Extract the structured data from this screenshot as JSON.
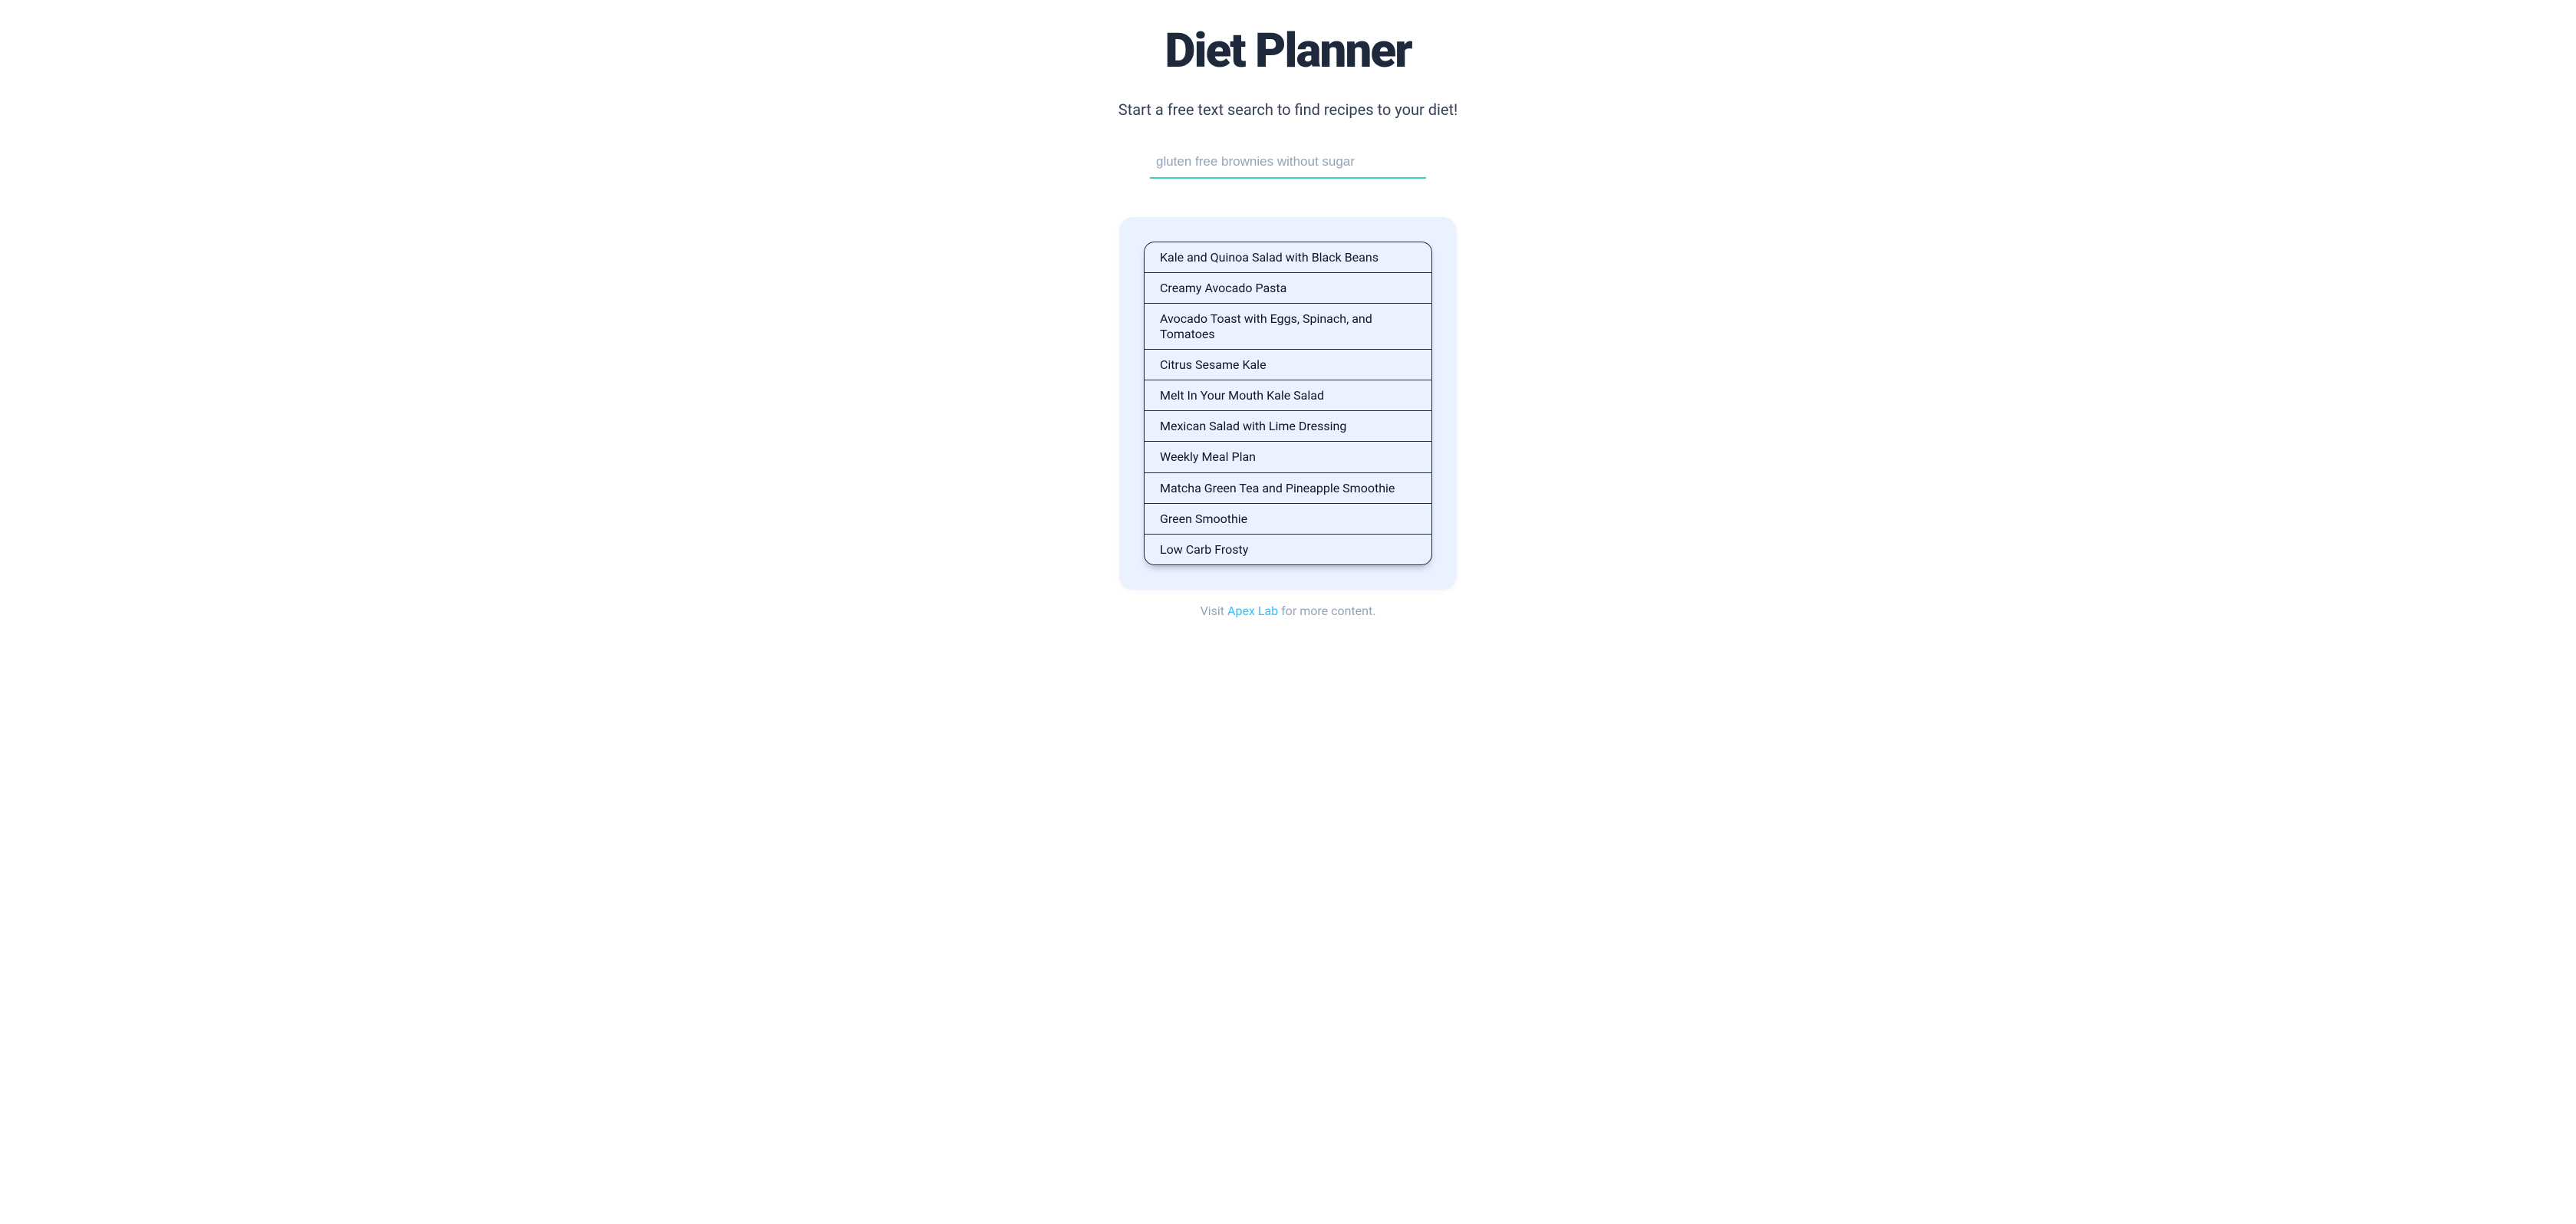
{
  "header": {
    "title": "Diet Planner",
    "subtitle": "Start a free text search to find recipes to your diet!"
  },
  "search": {
    "value": "",
    "placeholder": "gluten free brownies without sugar"
  },
  "results": [
    {
      "label": "Kale and Quinoa Salad with Black Beans"
    },
    {
      "label": "Creamy Avocado Pasta"
    },
    {
      "label": "Avocado Toast with Eggs, Spinach, and Tomatoes"
    },
    {
      "label": "Citrus Sesame Kale"
    },
    {
      "label": "Melt In Your Mouth Kale Salad"
    },
    {
      "label": "Mexican Salad with Lime Dressing"
    },
    {
      "label": "Weekly Meal Plan"
    },
    {
      "label": "Matcha Green Tea and Pineapple Smoothie"
    },
    {
      "label": "Green Smoothie"
    },
    {
      "label": "Low Carb Frosty"
    }
  ],
  "footer": {
    "prefix": "Visit ",
    "link_label": "Apex Lab",
    "suffix": " for more content."
  }
}
